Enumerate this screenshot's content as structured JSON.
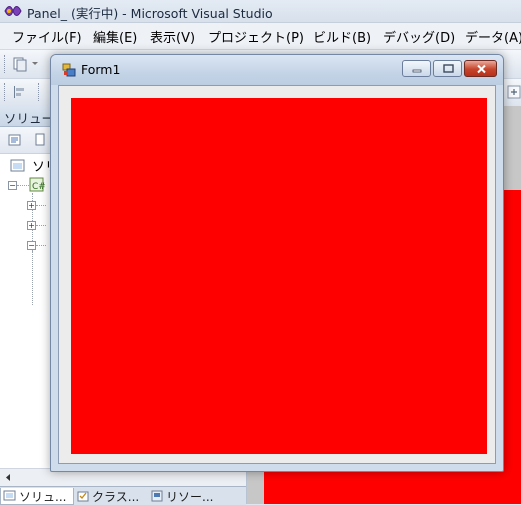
{
  "vs_window": {
    "title": "Panel_ (実行中) - Microsoft Visual Studio",
    "menu": [
      "ファイル(F)",
      "編集(E)",
      "表示(V)",
      "プロジェクト(P)",
      "ビルド(B)",
      "デバッグ(D)",
      "データ(A)"
    ]
  },
  "solution_explorer": {
    "header": "ソリュー",
    "root_label": "ソリ",
    "tabs": [
      "ソリュ...",
      "クラス...",
      "リソー..."
    ]
  },
  "form_window": {
    "title": "Form1",
    "panel_color": "#ff0000"
  },
  "colors": {
    "panel_red": "#ff0000",
    "form_frame": "#cfdceb",
    "close_button": "#c7452c"
  }
}
